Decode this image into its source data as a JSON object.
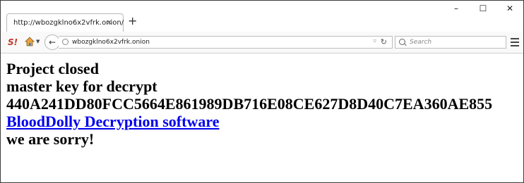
{
  "browser": {
    "tab_title": "http://wbozgklno6x2vfrk.onion/",
    "tab_close": "×",
    "new_tab": "+",
    "window_controls": {
      "minimize": "–",
      "maximize": "☐",
      "close": "✕"
    },
    "address": "wbozgklno6x2vfrk.onion",
    "search_placeholder": "Search",
    "icons": [
      "s-logo-icon",
      "home-icon",
      "back-arrow-icon",
      "globe-icon",
      "dropdown-icon",
      "reload-icon",
      "search-icon",
      "hamburger-menu-icon"
    ]
  },
  "page": {
    "line1": "Project closed",
    "line2": "master key for decrypt",
    "key": "440A241DD80FCC5664E861989DB716E08CE627D8D40C7EA360AE855",
    "link": "BloodDolly Decryption software",
    "line5": "we are sorry!",
    "link_color": "#0000ee"
  }
}
